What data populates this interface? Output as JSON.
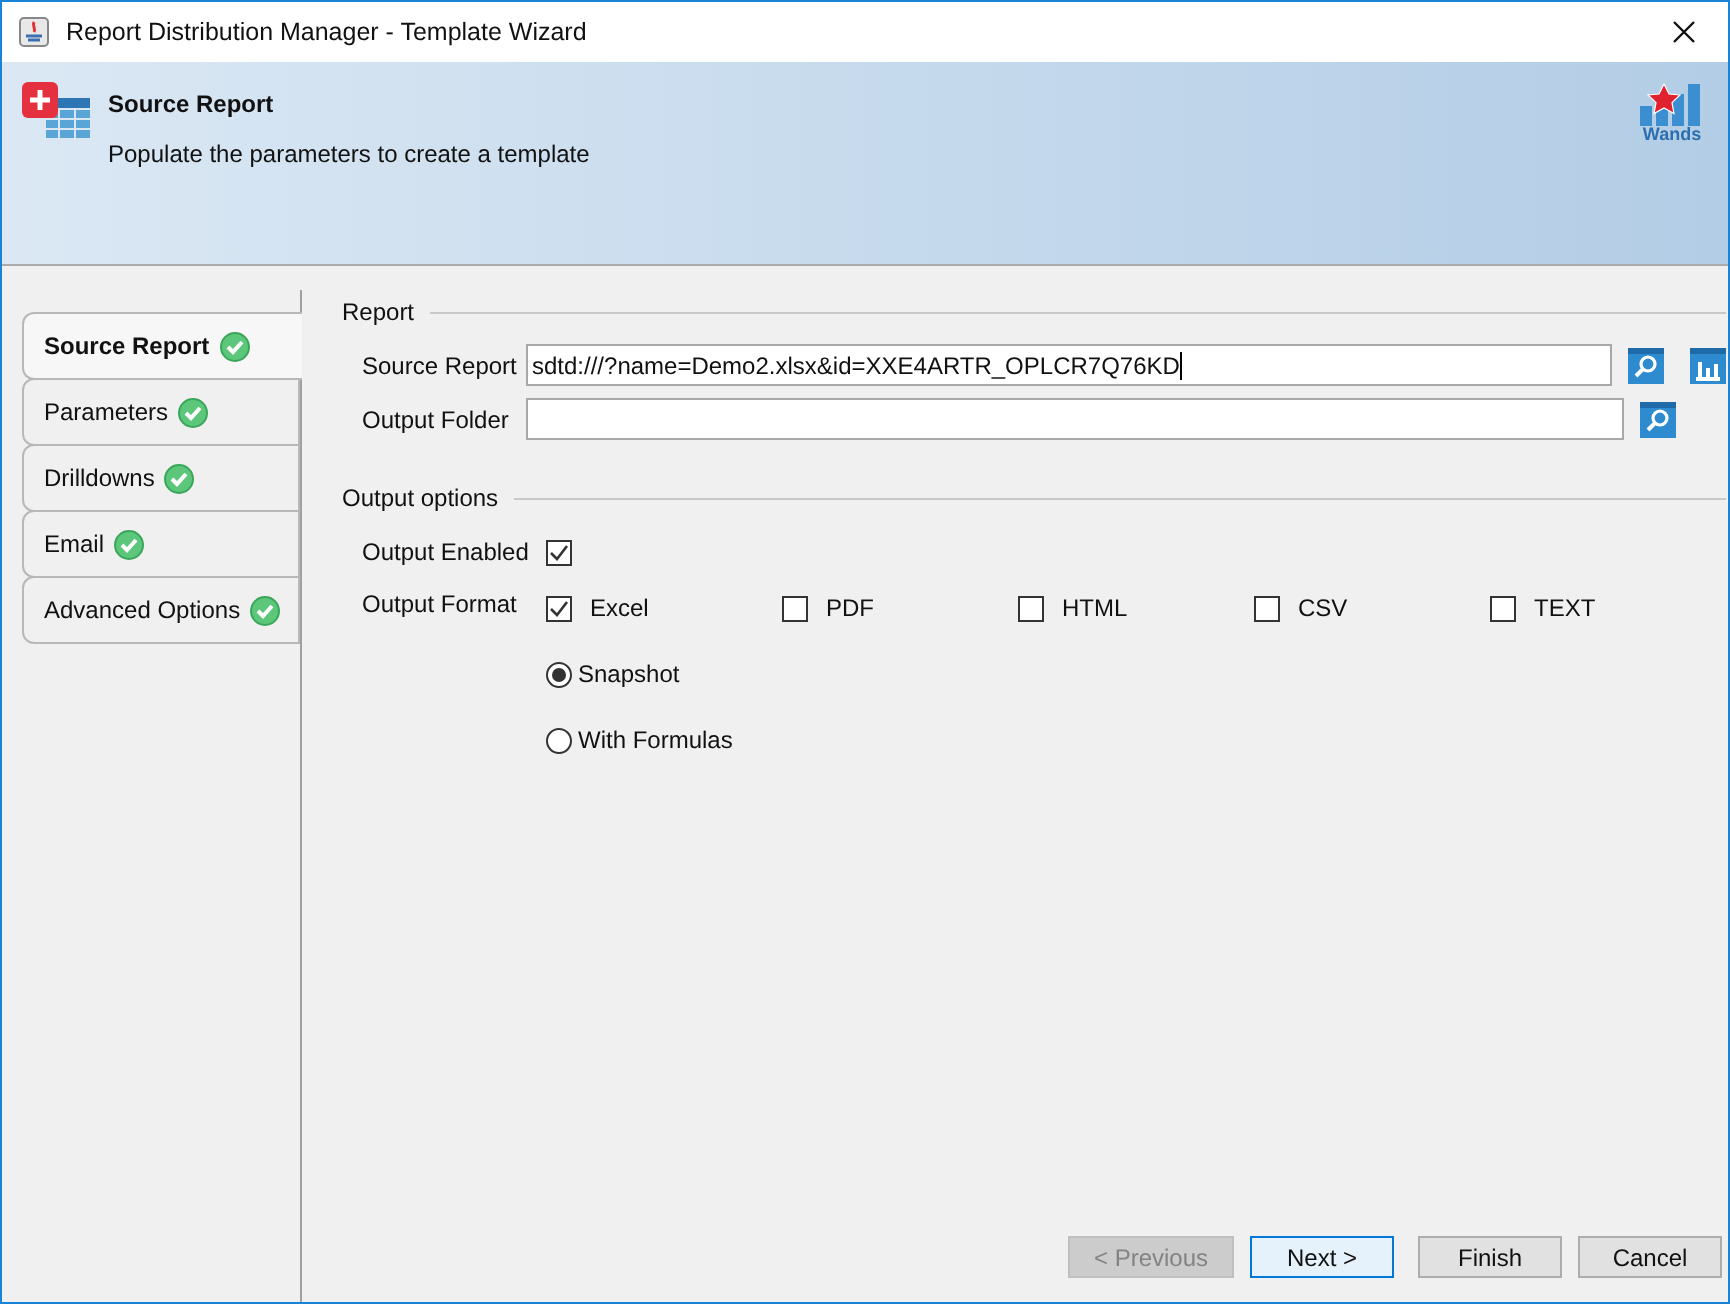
{
  "window": {
    "title": "Report Distribution Manager - Template Wizard"
  },
  "header": {
    "title": "Source Report",
    "subtitle": "Populate the parameters to create a template",
    "logo_text": "Wands"
  },
  "tabs": [
    {
      "label": "Source Report",
      "selected": true,
      "complete": true
    },
    {
      "label": "Parameters",
      "selected": false,
      "complete": true
    },
    {
      "label": "Drilldowns",
      "selected": false,
      "complete": true
    },
    {
      "label": "Email",
      "selected": false,
      "complete": true
    },
    {
      "label": "Advanced Options",
      "selected": false,
      "complete": true
    }
  ],
  "report_section": {
    "title": "Report",
    "source_report": {
      "label": "Source Report",
      "value": "sdtd:///?name=Demo2.xlsx&id=XXE4ARTR_OPLCR7Q76KD"
    },
    "output_folder": {
      "label": "Output Folder"
    }
  },
  "output_section": {
    "title": "Output options",
    "output_enabled": {
      "label": "Output Enabled",
      "checked": true
    },
    "output_format_label": "Output Format",
    "formats": [
      {
        "label": "Excel",
        "checked": true
      },
      {
        "label": "PDF",
        "checked": false
      },
      {
        "label": "HTML",
        "checked": false
      },
      {
        "label": "CSV",
        "checked": false
      },
      {
        "label": "TEXT",
        "checked": false
      }
    ],
    "modes": [
      {
        "label": "Snapshot",
        "selected": true
      },
      {
        "label": "With Formulas",
        "selected": false
      }
    ]
  },
  "buttons": [
    {
      "label": "< Previous",
      "disabled": true,
      "default": false
    },
    {
      "label": "Next >",
      "disabled": false,
      "default": true
    },
    {
      "label": "Finish",
      "disabled": false,
      "default": false
    },
    {
      "label": "Cancel",
      "disabled": false,
      "default": false
    }
  ]
}
